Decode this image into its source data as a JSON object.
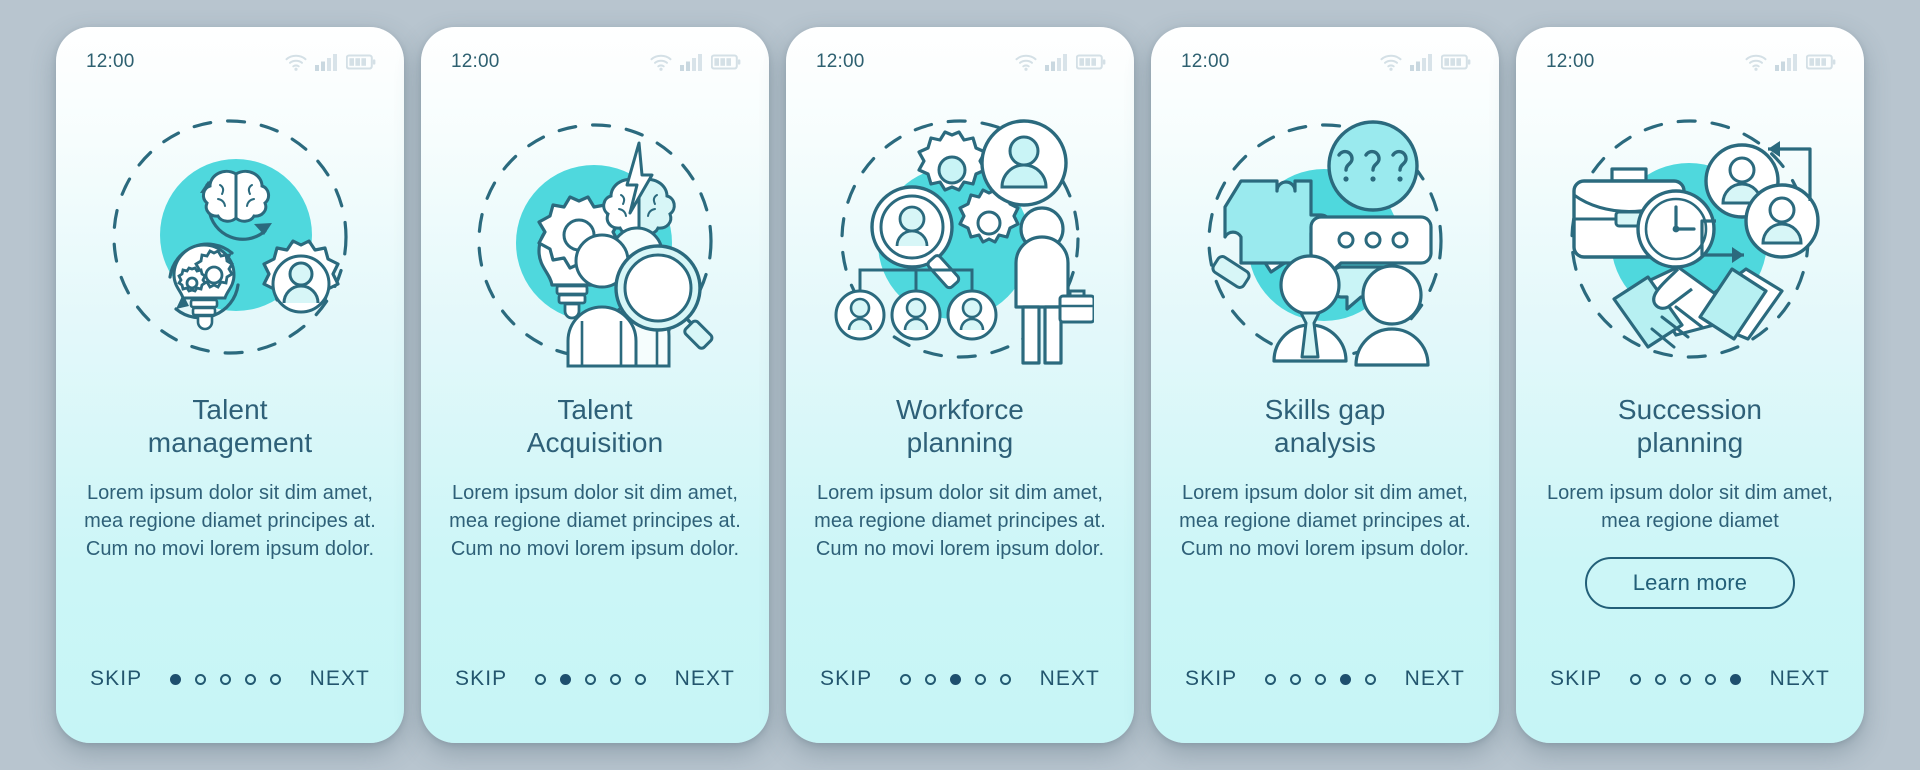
{
  "background_color": "#b8c5cf",
  "theme": {
    "accent": "#4fd8dd",
    "ink": "#2e6078",
    "stroke": "#2b6a7e",
    "card_top": "#ffffff",
    "card_bottom": "#c6f5f6"
  },
  "common": {
    "status_time": "12:00",
    "skip_label": "SKIP",
    "next_label": "NEXT",
    "icons": {
      "wifi": "wifi-icon",
      "signal": "cellular-signal-icon",
      "battery": "battery-icon"
    }
  },
  "screens": [
    {
      "id": "talent-management",
      "time": "12:00",
      "title": "Talent\nmanagement",
      "description": "Lorem ipsum dolor sit dim amet, mea regione diamet principes at. Cum no movi lorem ipsum dolor.",
      "illustration": "brain-gears-lightbulb-person-cycle",
      "skip": "SKIP",
      "next": "NEXT",
      "dots": [
        true,
        false,
        false,
        false,
        false
      ],
      "cta": null
    },
    {
      "id": "talent-acquisition",
      "time": "12:00",
      "title": "Talent\nAcquisition",
      "description": "Lorem ipsum dolor sit dim amet, mea regione diamet principes at. Cum no movi lorem ipsum dolor.",
      "illustration": "lightbulb-gear-brain-people-magnifier",
      "skip": "SKIP",
      "next": "NEXT",
      "dots": [
        false,
        true,
        false,
        false,
        false
      ],
      "cta": null
    },
    {
      "id": "workforce-planning",
      "time": "12:00",
      "title": "Workforce\nplanning",
      "description": "Lorem ipsum dolor sit dim amet, mea regione diamet principes at. Cum no movi lorem ipsum dolor.",
      "illustration": "org-chart-magnifier-gears-businessman",
      "skip": "SKIP",
      "next": "NEXT",
      "dots": [
        false,
        false,
        true,
        false,
        false
      ],
      "cta": null
    },
    {
      "id": "skills-gap-analysis",
      "time": "12:00",
      "title": "Skills gap\nanalysis",
      "description": "Lorem ipsum dolor sit dim amet, mea regione diamet principes at. Cum no movi lorem ipsum dolor.",
      "illustration": "hand-puzzle-question-bubbles-two-people",
      "skip": "SKIP",
      "next": "NEXT",
      "dots": [
        false,
        false,
        false,
        true,
        false
      ],
      "cta": null
    },
    {
      "id": "succession-planning",
      "time": "12:00",
      "title": "Succession\nplanning",
      "description": "Lorem ipsum dolor sit dim amet, mea regione diamet",
      "illustration": "briefcase-clock-avatars-handshake",
      "skip": "SKIP",
      "next": "NEXT",
      "dots": [
        false,
        false,
        false,
        false,
        true
      ],
      "cta": "Learn more"
    }
  ]
}
